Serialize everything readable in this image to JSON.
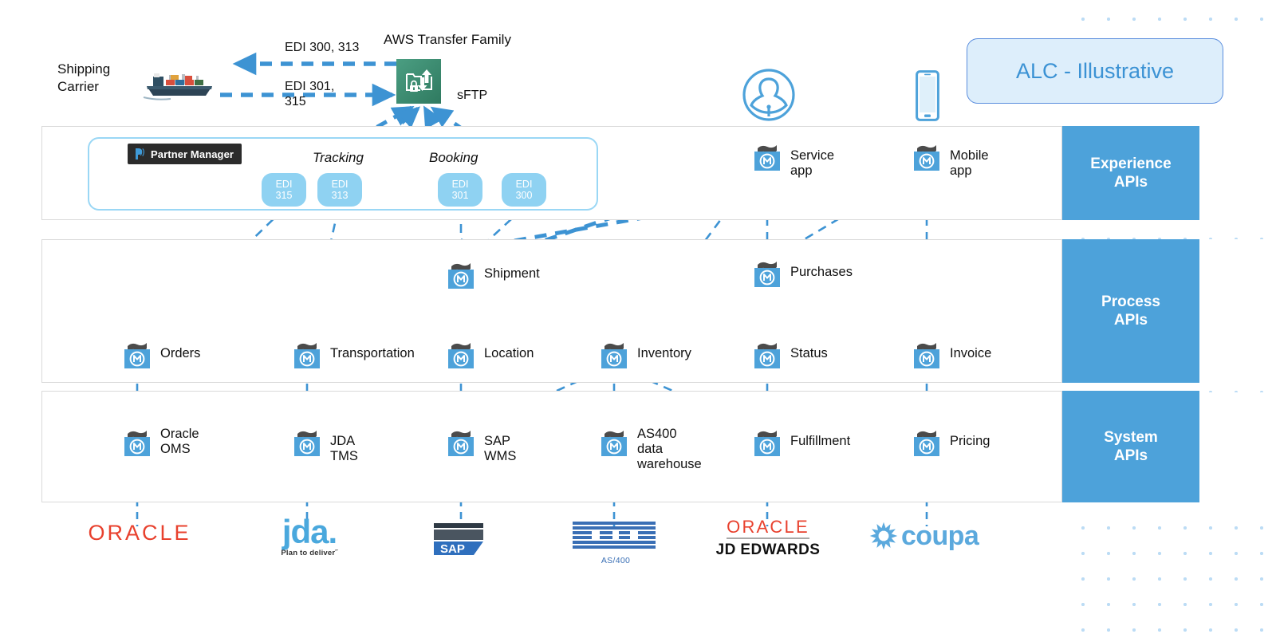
{
  "callout": {
    "text": "ALC - Illustrative"
  },
  "external": {
    "shipping_carrier_label": "Shipping\nCarrier",
    "ship_icon": "cargo-ship-icon",
    "aws": {
      "title": "AWS Transfer Family",
      "protocol": "sFTP",
      "icon": "aws-transfer-family-icon"
    },
    "flows": [
      {
        "label": "EDI 300, 313",
        "direction": "outbound-to-carrier"
      },
      {
        "label": "EDI 301,\n315",
        "direction": "inbound-to-aws"
      }
    ],
    "person_icon": "user-avatar-icon",
    "mobile_icon": "mobile-phone-icon"
  },
  "bands": [
    {
      "id": "experience",
      "label": "Experience\nAPIs",
      "line1": "Experience",
      "line2": "APIs"
    },
    {
      "id": "process",
      "label": "Process\nAPIs",
      "line1": "Process",
      "line2": "APIs"
    },
    {
      "id": "system",
      "label": "System\nAPIs",
      "line1": "System",
      "line2": "APIs"
    }
  ],
  "partner_manager": {
    "badge_label": "Partner Manager",
    "icon": "partner-manager-icon"
  },
  "edi_groups": [
    {
      "label": "Tracking"
    },
    {
      "label": "Booking"
    }
  ],
  "edi_nodes": [
    {
      "prefix": "EDI",
      "code": "315",
      "group": "Tracking"
    },
    {
      "prefix": "EDI",
      "code": "313",
      "group": "Tracking"
    },
    {
      "prefix": "EDI",
      "code": "301",
      "group": "Booking"
    },
    {
      "prefix": "EDI",
      "code": "300",
      "group": "Booking"
    }
  ],
  "experience_apis": [
    {
      "label": "Service app"
    },
    {
      "label": "Mobile app"
    }
  ],
  "process_apis_top": [
    {
      "label": "Shipment"
    },
    {
      "label": "Purchases"
    }
  ],
  "process_apis": [
    {
      "label": "Orders"
    },
    {
      "label": "Transportation"
    },
    {
      "label": "Location"
    },
    {
      "label": "Inventory"
    },
    {
      "label": "Status"
    },
    {
      "label": "Invoice"
    }
  ],
  "system_apis": [
    {
      "label": "Oracle\nOMS",
      "lines": 2
    },
    {
      "label": "JDA TMS",
      "lines": 1
    },
    {
      "label": "SAP WMS",
      "lines": 1
    },
    {
      "label": "AS400 data\nwarehouse",
      "lines": 2
    },
    {
      "label": "Fulfillment",
      "lines": 1
    },
    {
      "label": "Pricing",
      "lines": 1
    }
  ],
  "vendor_logos": [
    {
      "name": "oracle-logo",
      "text": "ORACLE",
      "sub": ""
    },
    {
      "name": "jda-logo",
      "text": "jda.",
      "sub": "Plan to deliver˝"
    },
    {
      "name": "sap-logo",
      "text": "SAP",
      "sub": ""
    },
    {
      "name": "ibm-logo",
      "text": "IBM",
      "sub": "AS/400"
    },
    {
      "name": "oracle-jd-edwards-logo",
      "text": "ORACLE",
      "sub": "JD EDWARDS"
    },
    {
      "name": "coupa-logo",
      "text": "coupa",
      "sub": ""
    }
  ],
  "colors": {
    "mulesoft_blue": "#4da2da",
    "band_blue": "#4da2da",
    "edi_pill": "#8fd2f2",
    "aws_green": "#3f8e72",
    "connector": "#3d93d3",
    "oracle_red": "#e8412e",
    "callout_fill": "#ddeefb",
    "callout_text": "#3b92d4",
    "dot_grid": "#bcdcf5"
  }
}
